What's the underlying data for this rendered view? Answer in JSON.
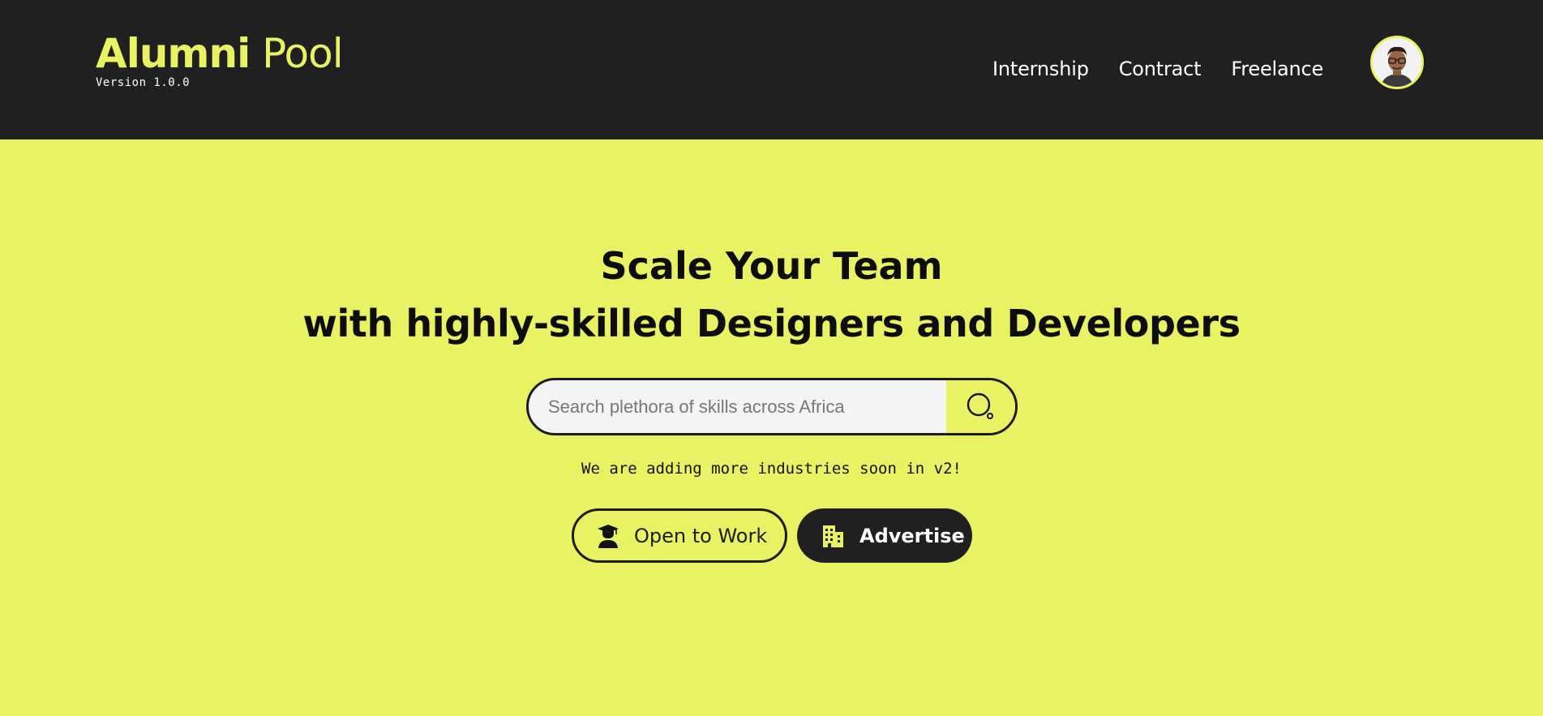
{
  "header": {
    "logo_bold": "Alumni",
    "logo_light": "Pool",
    "version": "Version 1.0.0",
    "nav": [
      {
        "label": "Internship"
      },
      {
        "label": "Contract"
      },
      {
        "label": "Freelance"
      }
    ],
    "avatar_icon": "user-avatar"
  },
  "hero": {
    "title_line1": "Scale Your Team",
    "title_line2": "with highly-skilled Designers and Developers",
    "search": {
      "placeholder": "Search plethora of skills across Africa",
      "value": "",
      "icon": "search-icon"
    },
    "note": "We are adding more industries soon in v2!",
    "buttons": {
      "open_to_work": {
        "label": "Open to Work",
        "icon": "graduate-icon"
      },
      "advertise": {
        "label": "Advertise",
        "icon": "building-icon"
      }
    }
  },
  "colors": {
    "accent": "#e8f263",
    "dark": "#202020",
    "text": "#0d0d0d"
  }
}
